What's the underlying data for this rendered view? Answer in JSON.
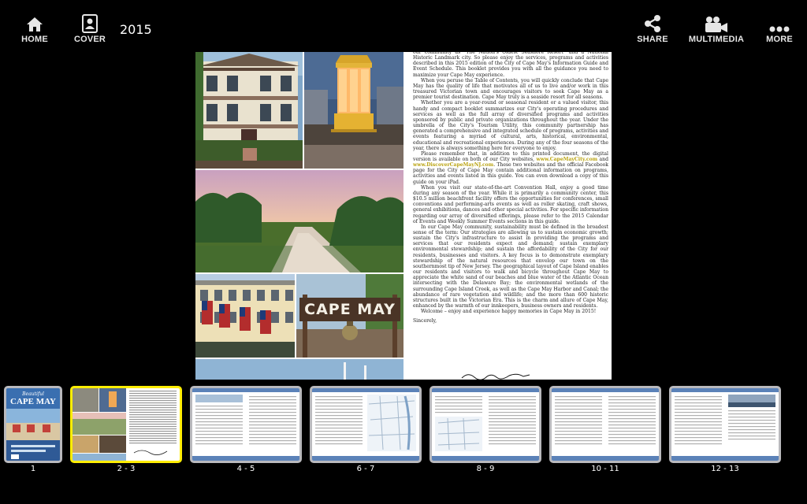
{
  "toolbar": {
    "home_label": "HOME",
    "cover_label": "COVER",
    "year": "2015",
    "share_label": "SHARE",
    "multimedia_label": "MULTIMEDIA",
    "more_label": "MORE"
  },
  "page": {
    "sign_text": "CAPE MAY",
    "paragraphs": [
      "our community as \"The Nation's Oldest Seashore Resort\" and a National Historic Landmark city. So please enjoy the services, programs and activities described in this 2015 edition of the City of Cape May's Information Guide and Event Schedule. This booklet provides you with all the guidance you need to maximize your Cape May experience.",
      "When you peruse the Table of Contents, you will quickly conclude that Cape May has the quality of life that motivates all of us to live and/or work in this treasured Victorian town and encourages visitors to seek Cape May as a premier tourist destination. Cape May truly is a seaside resort for all seasons.",
      "Whether you are a year-round or seasonal resident or a valued visitor, this handy and compact booklet summarizes our City's operating procedures and services as well as the full array of diversified programs and activities sponsored by public and private organizations throughout the year. Under the umbrella of the City's Tourism Utility, this community partnership has generated a comprehensive and integrated schedule of programs, activities and events featuring a myriad of cultural, arts, historical, environmental, educational and recreational experiences. During any of the four seasons of the year, there is always something here for everyone to enjoy.",
      "When you visit our state-of-the-art Convention Hall, enjoy a good time during any season of the year. While it is primarily a community center, this $10.5 million beachfront facility offers the opportunities for conferences, small conventions and performing-arts events as well as roller skating, craft shows, general exhibitions, dances and other special activities. For specific information regarding our array of diversified offerings, please refer to the 2015 Calendar of Events and Weekly Summer Events sections in this guide.",
      "In our Cape May community, sustainability must be defined in the broadest sense of the term: Our strategies are allowing us to sustain economic growth; sustain the City's infrastructure to assist in providing the programs and services that our residents expect and demand; sustain exemplary environmental stewardship; and sustain the affordability of the City for our residents, businesses and visitors. A key focus is to demonstrate exemplary stewardship of the natural resources that envelop our town on the southernmost tip of New Jersey. The geographical layout of Cape Island enables our residents and visitors to walk and bicycle throughout Cape May to appreciate the white sand of our beaches and blue water of the Atlantic Ocean intersecting with the Delaware Bay; the environmental wetlands of the surrounding Cape Island Creek, as well as the Cape May Harbor and Canal; the abundance of rare vegetation and wildlife; and the more than 600 historic structures built in the Victorian Era. This is the charm and allure of Cape May, enhanced by the warmth of our innkeepers, business owners and residents.",
      "Welcome – enjoy and experience happy memories in Cape May in 2015!"
    ],
    "web_para": {
      "before": "Please remember that, in addition to this printed document, the digital version is available on both of our City websites, ",
      "link1": "www.CapeMayCity.com",
      "mid": " and ",
      "link2": "www.DiscoverCapeMayNJ.com",
      "after": ". These two websites and the official Facebook page for the City of Cape May contain additional information on programs, activities and events listed in this guide. You can even download a copy of this guide on your iPad."
    },
    "closing": "Sincerely,"
  },
  "thumbnails": [
    {
      "label": "1",
      "selected": false
    },
    {
      "label": "2 - 3",
      "selected": true
    },
    {
      "label": "4 - 5",
      "selected": false
    },
    {
      "label": "6 - 7",
      "selected": false
    },
    {
      "label": "8 - 9",
      "selected": false
    },
    {
      "label": "10 - 11",
      "selected": false
    },
    {
      "label": "12 - 13",
      "selected": false
    }
  ],
  "cover_thumb": {
    "script_title": "Beautiful",
    "title": "CAPE MAY"
  },
  "colors": {
    "background": "#000000",
    "selected_border": "#ffee00",
    "thumb_border": "#b9b9bd",
    "link_highlight": "#b9a20e",
    "thumb_header_blue": "#5b82b8"
  }
}
